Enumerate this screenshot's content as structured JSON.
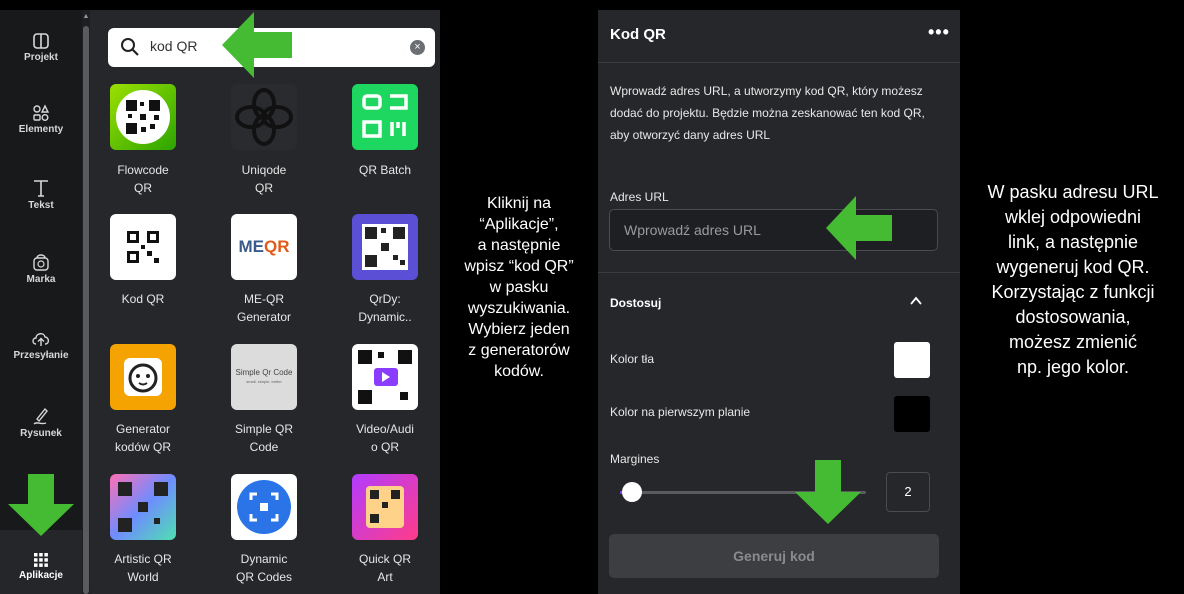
{
  "sidebar": {
    "items": [
      {
        "label": "Projekt",
        "icon": "layout-icon"
      },
      {
        "label": "Elementy",
        "icon": "elements-icon"
      },
      {
        "label": "Tekst",
        "icon": "text-icon"
      },
      {
        "label": "Marka",
        "icon": "brand-icon"
      },
      {
        "label": "Przesyłanie",
        "icon": "upload-cloud-icon"
      },
      {
        "label": "Rysunek",
        "icon": "draw-icon"
      },
      {
        "label": "Aplikacje",
        "icon": "apps-grid-icon"
      }
    ],
    "active": "Aplikacje"
  },
  "search": {
    "value": "kod QR"
  },
  "apps": [
    {
      "name": "Flowcode QR",
      "line1": "Flowcode",
      "line2": "QR"
    },
    {
      "name": "Uniqode QR",
      "line1": "Uniqode",
      "line2": "QR"
    },
    {
      "name": "QR Batch",
      "line1": "QR Batch",
      "line2": ""
    },
    {
      "name": "Kod QR",
      "line1": "Kod QR",
      "line2": ""
    },
    {
      "name": "ME-QR Generator",
      "line1": "ME-QR",
      "line2": "Generator",
      "logo_left": "ME",
      "logo_right": "QR"
    },
    {
      "name": "QrDy: Dynamic..",
      "line1": "QrDy:",
      "line2": "Dynamic.."
    },
    {
      "name": "Generator kodów QR",
      "line1": "Generator",
      "line2": "kodów QR"
    },
    {
      "name": "Simple QR Code",
      "line1": "Simple QR",
      "line2": "Code",
      "logo_text": "Simple Qr Code",
      "logo_sub": "small. simple. better"
    },
    {
      "name": "Video/Audio QR",
      "line1": "Video/Audi",
      "line2": "o QR"
    },
    {
      "name": "Artistic QR World",
      "line1": "Artistic QR",
      "line2": "World"
    },
    {
      "name": "Dynamic QR Codes",
      "line1": "Dynamic",
      "line2": "QR Codes"
    },
    {
      "name": "Quick QR Art",
      "line1": "Quick QR",
      "line2": "Art"
    }
  ],
  "captions": {
    "middle": [
      "Kliknij na",
      "“Aplikacje”,",
      "a następnie",
      "wpisz “kod QR”",
      "w pasku",
      "wyszukiwania.",
      "Wybierz jeden",
      "z generatorów",
      "kodów."
    ],
    "right": [
      "W pasku adresu URL",
      "wklej odpowiedni",
      "link, a następnie",
      "wygeneruj kod QR.",
      "Korzystając z funkcji",
      "dostosowania,",
      "możesz zmienić",
      "np. jego kolor."
    ]
  },
  "panel": {
    "title": "Kod QR",
    "more": "•••",
    "description": "Wprowadź adres URL, a utworzymy kod QR, który możesz dodać do projektu. Będzie można zeskanować ten kod QR, aby otworzyć dany adres URL",
    "url_label": "Adres URL",
    "url_placeholder": "Wprowadź adres URL",
    "customize_label": "Dostosuj",
    "bg_color_label": "Kolor tła",
    "bg_color": "#ffffff",
    "fg_color_label": "Kolor na pierwszym planie",
    "fg_color": "#000000",
    "margin_label": "Margines",
    "margin_value": "2",
    "generate_label": "Generuj kod"
  },
  "colors": {
    "arrow": "#44bb33",
    "accent": "#8b3dff"
  }
}
